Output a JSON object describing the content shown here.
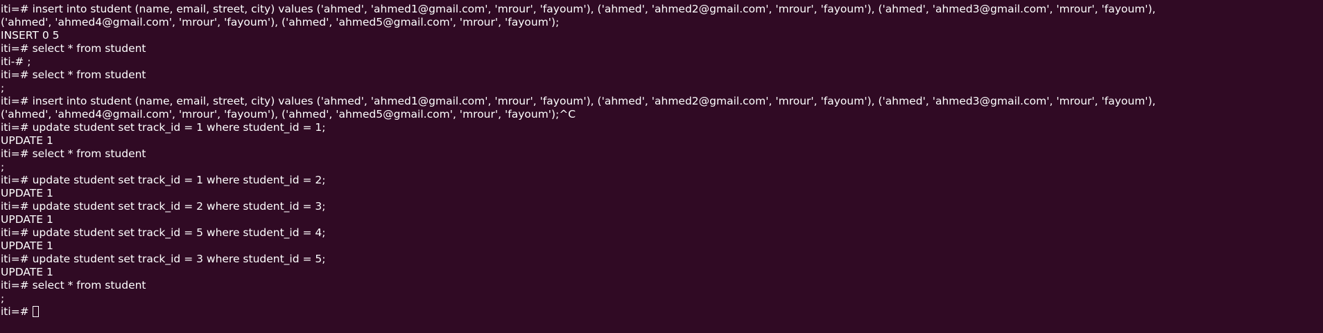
{
  "terminal": {
    "top_caret": "^",
    "lines": [
      "iti=# insert into student (name, email, street, city) values ('ahmed', 'ahmed1@gmail.com', 'mrour', 'fayoum'), ('ahmed', 'ahmed2@gmail.com', 'mrour', 'fayoum'), ('ahmed', 'ahmed3@gmail.com', 'mrour', 'fayoum'),",
      "('ahmed', 'ahmed4@gmail.com', 'mrour', 'fayoum'), ('ahmed', 'ahmed5@gmail.com', 'mrour', 'fayoum');",
      "INSERT 0 5",
      "iti=# select * from student",
      "iti-# ;",
      "iti=# select * from student",
      ";",
      "iti=# insert into student (name, email, street, city) values ('ahmed', 'ahmed1@gmail.com', 'mrour', 'fayoum'), ('ahmed', 'ahmed2@gmail.com', 'mrour', 'fayoum'), ('ahmed', 'ahmed3@gmail.com', 'mrour', 'fayoum'),",
      "('ahmed', 'ahmed4@gmail.com', 'mrour', 'fayoum'), ('ahmed', 'ahmed5@gmail.com', 'mrour', 'fayoum');^C",
      "iti=# update student set track_id = 1 where student_id = 1;",
      "UPDATE 1",
      "iti=# select * from student",
      ";",
      "iti=# update student set track_id = 1 where student_id = 2;",
      "UPDATE 1",
      "iti=# update student set track_id = 2 where student_id = 3;",
      "UPDATE 1",
      "iti=# update student set track_id = 5 where student_id = 4;",
      "UPDATE 1",
      "iti=# update student set track_id = 3 where student_id = 5;",
      "UPDATE 1",
      "iti=# select * from student",
      ";"
    ],
    "prompt": "iti=# "
  },
  "colors": {
    "background": "#300a24",
    "foreground": "#ffffff"
  }
}
